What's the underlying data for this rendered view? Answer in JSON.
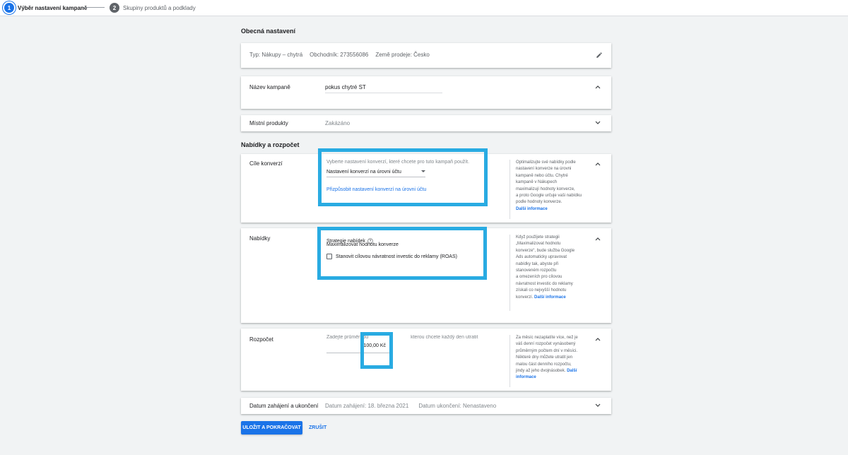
{
  "stepper": {
    "step1": {
      "number": "1",
      "label": "Výběr nastavení kampaně"
    },
    "step2": {
      "number": "2",
      "label": "Skupiny produktů a podklady"
    }
  },
  "general": {
    "title": "Obecná nastavení",
    "type": "Typ: Nákupy – chytrá",
    "merchant": "Obchodník: 273556086",
    "country": "Země prodeje: Česko"
  },
  "campaign_name": {
    "label": "Název kampaně",
    "value": "pokus chytré ST"
  },
  "local_products": {
    "label": "Místní produkty",
    "value": "Zakázáno"
  },
  "bids_budget": {
    "title": "Nabídky a rozpočet"
  },
  "conversion_goals": {
    "label": "Cíle konverzí",
    "instruction": "Vyberte nastavení konverzí, které chcete pro tuto kampaň použít.",
    "dropdown_value": "Nastavení konverzí na úrovni účtu",
    "customize_link": "Přizpůsobit nastavení konverzí na úrovni účtu",
    "note_lines": [
      "Optimalizujte své nabídky podle",
      "nastavení konverze na úrovni",
      "kampaně nebo účtu. Chytré",
      "kampaně v Nákupech",
      "maximalizují hodnoty konverze,",
      "a proto Google určuje vaši nabídku",
      "podle hodnoty konverze."
    ],
    "note_link": "Další informace"
  },
  "bidding": {
    "label": "Nabídky",
    "strategy_label": "Strategie nabídek",
    "strategy_value": "Maximalizovat hodnotu konverze",
    "checkbox_label": "Stanovit cílovou návratnost investic do reklamy (ROAS)",
    "note_lines": [
      "Když použijete strategii",
      "„Maximalizovat hodnotu",
      "konverze“, bude služba Google",
      "Ads automaticky upravovat",
      "nabídky tak, abyste při",
      "stanoveném rozpočtu",
      "a omezeních pro cílovou",
      "návratnost investic do reklamy",
      "získali co nejvyšší hodnotu"
    ],
    "note_tail": "konverzí.",
    "note_link": "Další informace"
  },
  "budget": {
    "label": "Rozpočet",
    "instruction_start": "Zadejte průměrnou ",
    "instruction_end": "kterou chcete každý den utratit",
    "value": "100,00 Kč",
    "note_lines": [
      "Za měsíc nezaplatíte více, než je",
      "váš denní rozpočet vynásobený",
      "průměrným počtem dní v měsíci.",
      "Některé dny můžete utratit jen",
      "malou část denního rozpočtu,"
    ],
    "note_tail": "jindy až jeho dvojnásobek.",
    "note_link": "Další informace"
  },
  "dates": {
    "label": "Datum zahájení a ukončení",
    "start": "Datum zahájení: 18. března 2021",
    "end": "Datum ukončení: Nenastaveno"
  },
  "actions": {
    "save": "ULOŽIT A POKRAČOVAT",
    "cancel": "ZRUŠIT"
  },
  "colors": {
    "accent": "#1a73e8",
    "highlight": "#29abe2",
    "background": "#f1f3f4"
  }
}
